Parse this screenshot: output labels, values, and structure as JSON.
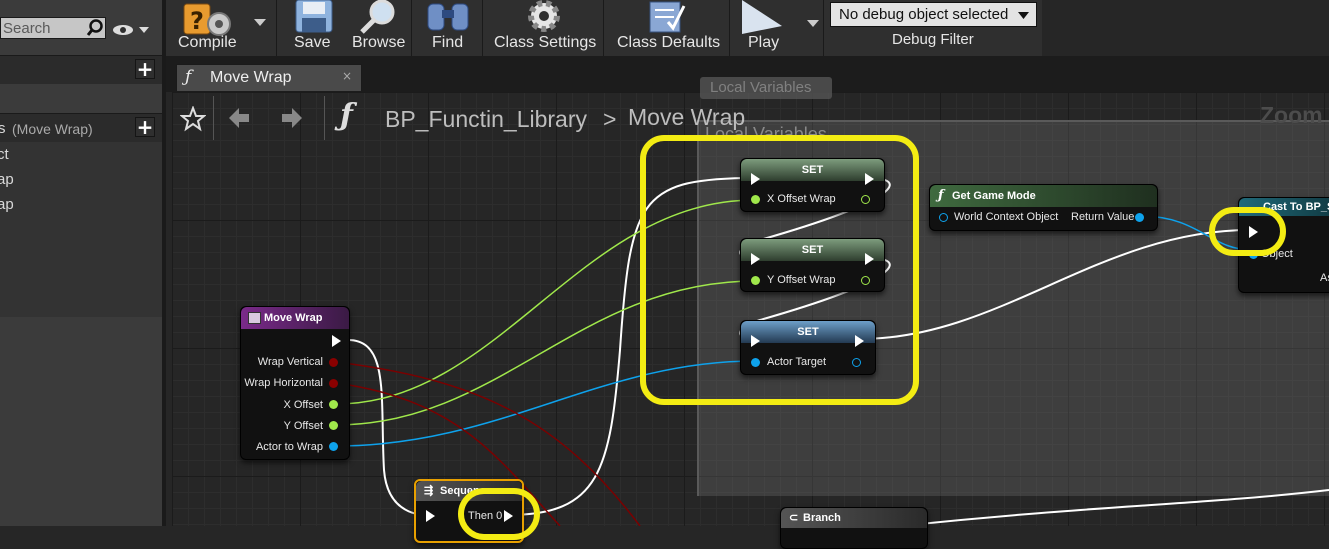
{
  "left_panel": {
    "search_placeholder": "Search",
    "section_title": "s",
    "section_subtitle": "(Move Wrap)",
    "variables": [
      "ct",
      "ap",
      "ap"
    ],
    "add_label": "+"
  },
  "toolbar": {
    "compile_label": "Compile",
    "save_label": "Save",
    "browse_label": "Browse",
    "find_label": "Find",
    "class_settings_label": "Class Settings",
    "class_defaults_label": "Class Defaults",
    "play_label": "Play",
    "debug_select_value": "No debug object selected",
    "debug_filter_label": "Debug Filter"
  },
  "tab": {
    "label": "Move Wrap",
    "close": "×"
  },
  "breadcrumb": {
    "root": "BP_Functin_Library",
    "separator": ">",
    "current": "Move Wrap",
    "zoom": "Zoom"
  },
  "graph": {
    "comment_title": "Local Variables",
    "comment_title_top": "Local Variables",
    "nodes": {
      "move_wrap": {
        "title": "Move Wrap",
        "pins": [
          "Wrap Vertical",
          "Wrap Horizontal",
          "X Offset",
          "Y Offset",
          "Actor to Wrap"
        ]
      },
      "set_x": {
        "title": "SET",
        "pin": "X Offset Wrap"
      },
      "set_y": {
        "title": "SET",
        "pin": "Y Offset Wrap"
      },
      "set_actor": {
        "title": "SET",
        "pin": "Actor Target"
      },
      "get_game_mode": {
        "title": "Get Game Mode",
        "in_pin": "World Context Object",
        "out_pin": "Return Value"
      },
      "cast": {
        "title": "Cast To BP_S",
        "pin": "Object",
        "pin2": "As"
      },
      "sequence": {
        "title": "Sequence",
        "pin": "Then 0"
      },
      "branch": {
        "title": "Branch"
      }
    }
  },
  "colors": {
    "highlight": "#f3ec13",
    "float_pin": "#a0e84b",
    "object_pin": "#0ea2ec",
    "bool_pin": "#8a0000",
    "function_header": "#5a2a6a",
    "set_header": "#4a6a4a"
  }
}
